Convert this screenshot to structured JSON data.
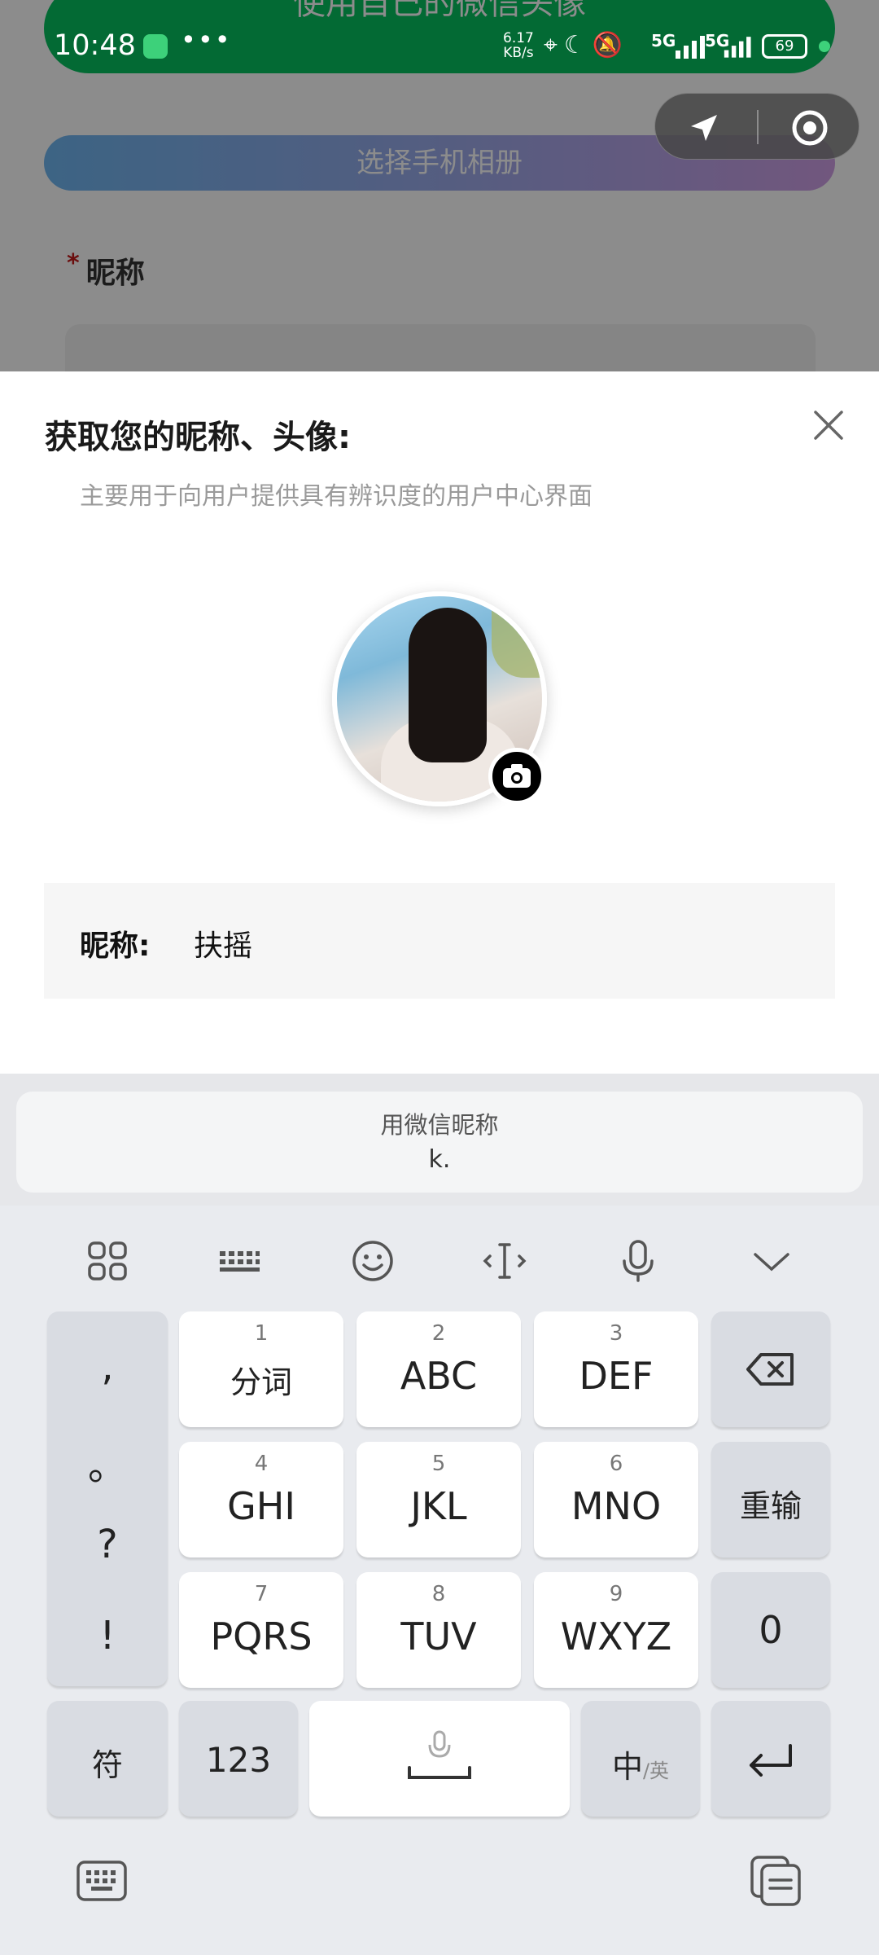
{
  "background_page": {
    "top_button_label": "使用自己的微信头像",
    "album_button_label": "选择手机相册",
    "nickname_title": "昵称",
    "required_mark": "*"
  },
  "status_bar": {
    "time": "10:48",
    "dots": "•••",
    "speed_value": "6.17",
    "speed_unit": "KB/s",
    "network_1": "5G",
    "network_2": "5G",
    "battery": "69"
  },
  "dialog": {
    "title": "获取您的昵称、头像:",
    "subtitle": "主要用于向用户提供具有辨识度的用户中心界面",
    "nickname_label": "昵称:",
    "nickname_value": "扶摇"
  },
  "suggestion": {
    "line1": "用微信昵称",
    "line2": "k."
  },
  "keyboard": {
    "punct": [
      ",",
      "。",
      "?",
      "!"
    ],
    "row1": [
      {
        "num": "1",
        "label": "分词"
      },
      {
        "num": "2",
        "label": "ABC"
      },
      {
        "num": "3",
        "label": "DEF"
      }
    ],
    "row2": [
      {
        "num": "4",
        "label": "GHI"
      },
      {
        "num": "5",
        "label": "JKL"
      },
      {
        "num": "6",
        "label": "MNO"
      }
    ],
    "row3": [
      {
        "num": "7",
        "label": "PQRS"
      },
      {
        "num": "8",
        "label": "TUV"
      },
      {
        "num": "9",
        "label": "WXYZ"
      }
    ],
    "reinput": "重输",
    "zero": "0",
    "symbols": "符",
    "numbers": "123",
    "lang_main": "中",
    "lang_alt": "/英"
  }
}
